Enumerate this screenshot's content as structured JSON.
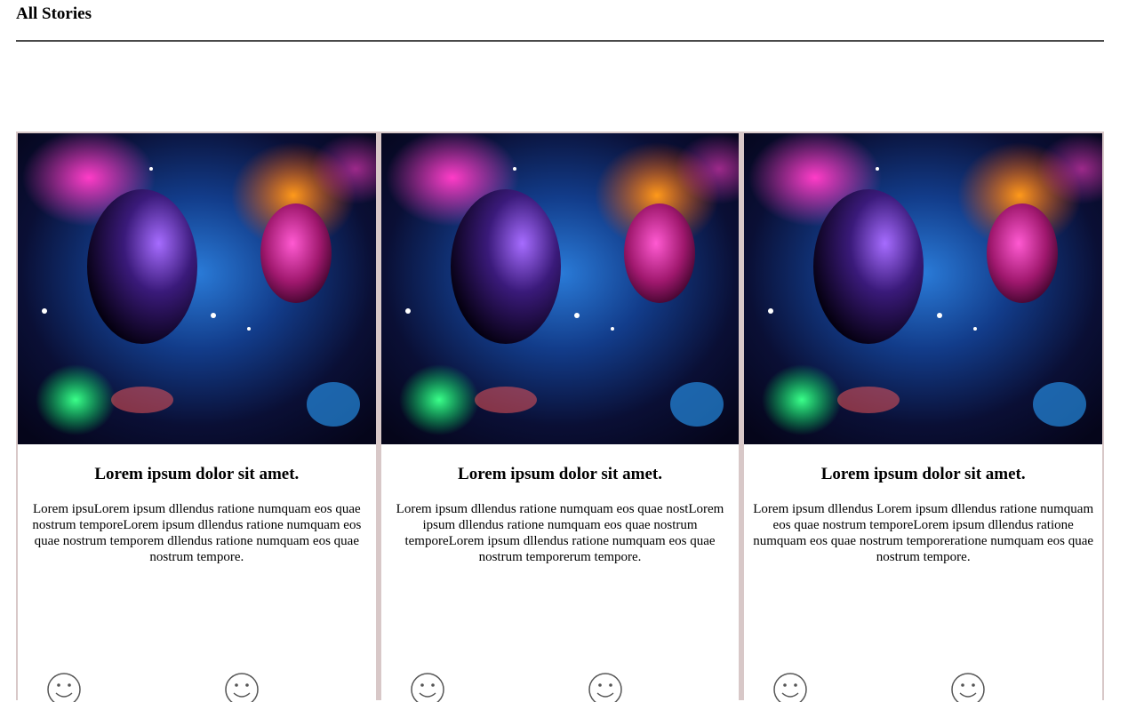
{
  "page": {
    "title": "All Stories"
  },
  "cards": [
    {
      "image_alt": "space-galaxy-image",
      "title": "Lorem ipsum dolor sit amet.",
      "text": "Lorem ipsuLorem ipsum dllendus ratione numquam eos quae nostrum temporeLorem ipsum dllendus ratione numquam eos quae nostrum temporem dllendus ratione numquam eos quae nostrum tempore."
    },
    {
      "image_alt": "space-galaxy-image",
      "title": "Lorem ipsum dolor sit amet.",
      "text": "Lorem ipsum dllendus ratione numquam eos quae nostLorem ipsum dllendus ratione numquam eos quae nostrum temporeLorem ipsum dllendus ratione numquam eos quae nostrum temporerum tempore."
    },
    {
      "image_alt": "space-galaxy-image",
      "title": "Lorem ipsum dolor sit amet.",
      "text": "Lorem ipsum dllendus Lorem ipsum dllendus ratione numquam eos quae nostrum temporeLorem ipsum dllendus ratione numquam eos quae nostrum temporeratione numquam eos quae nostrum tempore."
    }
  ],
  "icons": {
    "reaction_icon": "smiley-face-icon"
  }
}
